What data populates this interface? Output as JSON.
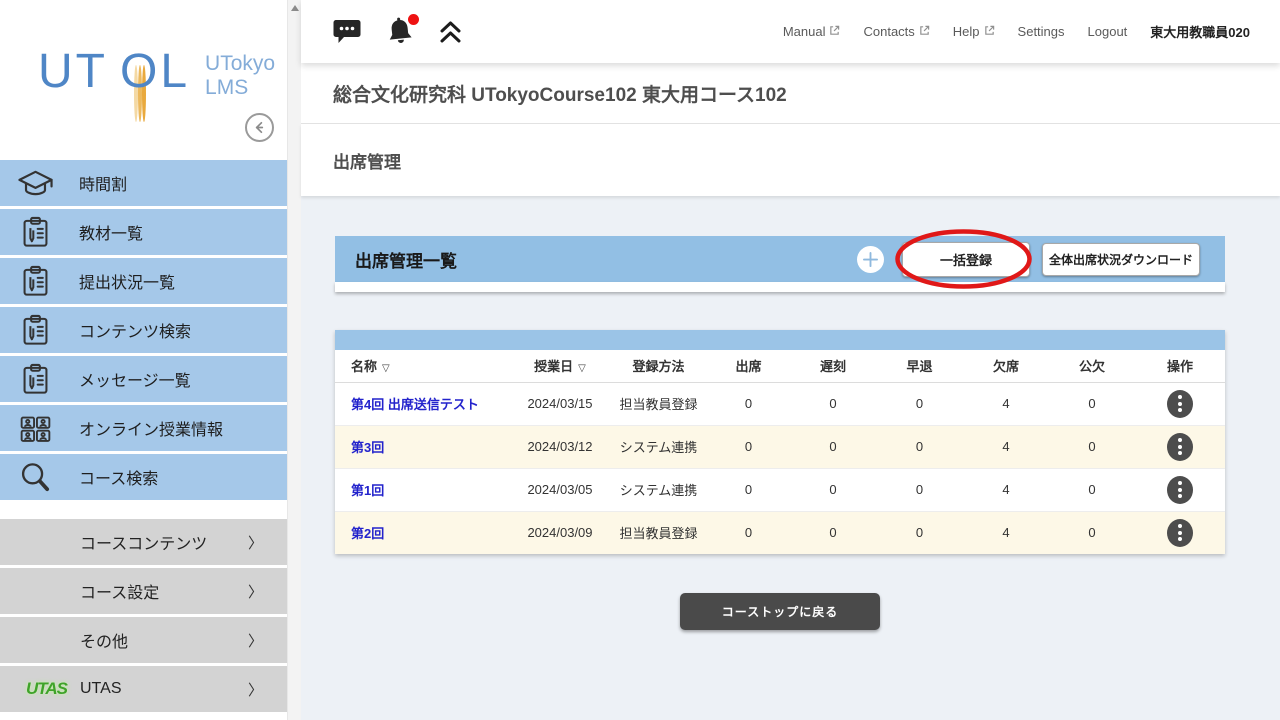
{
  "colors": {
    "sidebar_item_bg": "#a5c8e9",
    "sidebar_gray_bg": "#d3d3d3",
    "panel_header_bg": "#92bfe4",
    "table_strip_bg": "#9bc4e7",
    "row_alt_bg": "#fdf8e7",
    "content_bg": "#edf1f6",
    "link_blue": "#2323cc",
    "annotation_red": "#e01818",
    "notification_red": "#ee1212",
    "dark_button_bg": "#4a4a4a"
  },
  "sidebar": {
    "logo_text": "UTOL",
    "logo_subtitle_1": "UTokyo",
    "logo_subtitle_2": "LMS",
    "back_icon": "arrow-left-circle-icon",
    "menu_items": [
      {
        "label": "時間割",
        "icon": "graduation-cap-icon"
      },
      {
        "label": "教材一覧",
        "icon": "clipboard-icon"
      },
      {
        "label": "提出状況一覧",
        "icon": "clipboard-icon"
      },
      {
        "label": "コンテンツ検索",
        "icon": "clipboard-icon"
      },
      {
        "label": "メッセージ一覧",
        "icon": "clipboard-icon"
      },
      {
        "label": "オンライン授業情報",
        "icon": "video-grid-icon"
      },
      {
        "label": "コース検索",
        "icon": "search-icon"
      }
    ],
    "collapsible_items": [
      {
        "label": "コースコンテンツ",
        "icon": null
      },
      {
        "label": "コース設定",
        "icon": null
      },
      {
        "label": "その他",
        "icon": null
      },
      {
        "label": "UTAS",
        "icon": "utas-logo-icon"
      }
    ],
    "chevron": "〉"
  },
  "topbar": {
    "icons": [
      {
        "name": "chat-icon"
      },
      {
        "name": "bell-icon",
        "notification": true
      },
      {
        "name": "collapse-icon"
      }
    ],
    "links": [
      {
        "label": "Manual",
        "external": true
      },
      {
        "label": "Contacts",
        "external": true
      },
      {
        "label": "Help",
        "external": true
      },
      {
        "label": "Settings",
        "external": false
      },
      {
        "label": "Logout",
        "external": false
      }
    ],
    "username": "東大用教職員020"
  },
  "page": {
    "course_title": "総合文化研究科 UTokyoCourse102 東大用コース102",
    "section_title": "出席管理"
  },
  "panel": {
    "title": "出席管理一覧",
    "add_icon": "plus-circle-icon",
    "buttons": [
      {
        "label": "一括登録",
        "annotated": true
      },
      {
        "label": "全体出席状況ダウンロード",
        "annotated": false
      }
    ],
    "annotation": {
      "shape": "ellipse",
      "target": "一括登録",
      "color": "#e01818"
    }
  },
  "table": {
    "columns": [
      {
        "label": "名称",
        "sortable": true
      },
      {
        "label": "授業日",
        "sortable": true
      },
      {
        "label": "登録方法",
        "sortable": false
      },
      {
        "label": "出席",
        "sortable": false
      },
      {
        "label": "遅刻",
        "sortable": false
      },
      {
        "label": "早退",
        "sortable": false
      },
      {
        "label": "欠席",
        "sortable": false
      },
      {
        "label": "公欠",
        "sortable": false
      },
      {
        "label": "操作",
        "sortable": false
      }
    ],
    "sort_glyph": "▽",
    "rows": [
      {
        "name": "第4回 出席送信テスト",
        "date": "2024/03/15",
        "method": "担当教員登録",
        "present": "0",
        "late": "0",
        "early": "0",
        "absent": "4",
        "excused": "0",
        "action_icon": "kebab-menu-icon"
      },
      {
        "name": "第3回",
        "date": "2024/03/12",
        "method": "システム連携",
        "present": "0",
        "late": "0",
        "early": "0",
        "absent": "4",
        "excused": "0",
        "action_icon": "kebab-menu-icon"
      },
      {
        "name": "第1回",
        "date": "2024/03/05",
        "method": "システム連携",
        "present": "0",
        "late": "0",
        "early": "0",
        "absent": "4",
        "excused": "0",
        "action_icon": "kebab-menu-icon"
      },
      {
        "name": "第2回",
        "date": "2024/03/09",
        "method": "担当教員登録",
        "present": "0",
        "late": "0",
        "early": "0",
        "absent": "4",
        "excused": "0",
        "action_icon": "kebab-menu-icon"
      }
    ]
  },
  "footer": {
    "back_to_course_top": "コーストップに戻る"
  }
}
